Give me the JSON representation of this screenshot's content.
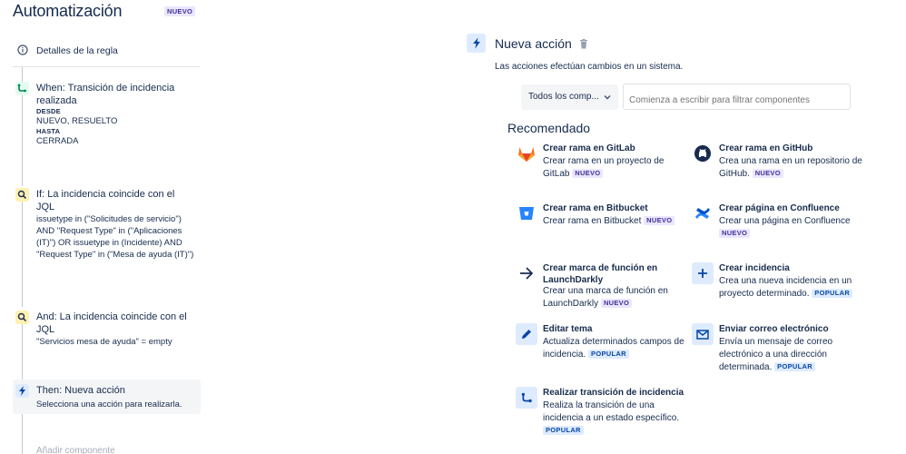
{
  "app": {
    "title": "Automatización",
    "badge": "NUEVO"
  },
  "rule_details": {
    "label": "Detalles de la regla"
  },
  "steps": [
    {
      "title": "When: Transición de incidencia realizada",
      "from_caption": "DESDE",
      "from_value": "NUEVO, RESUELTO",
      "to_caption": "HASTA",
      "to_value": "CERRADA"
    },
    {
      "title": "If: La incidencia coincide con el JQL",
      "body": "issuetype in (\"Solicitudes de servicio\") AND \"Request Type\" in (\"Aplicaciones (IT)\") OR issuetype in (Incidente) AND \"Request Type\" in (\"Mesa de ayuda (IT)\")"
    },
    {
      "title": "And: La incidencia coincide con el JQL",
      "body": "\"Servicios mesa de ayuda\" = empty"
    },
    {
      "title": "Then: Nueva acción",
      "body": "Selecciona una acción para realizarla."
    }
  ],
  "add_component": "Añadir componente",
  "panel": {
    "title": "Nueva acción",
    "description": "Las acciones efectúan cambios en un sistema.",
    "select_value": "Todos los comp...",
    "filter_placeholder": "Comienza a escribir para filtrar componentes",
    "section_title": "Recomendado"
  },
  "actions": [
    {
      "title": "Crear rama en GitLab",
      "desc": "Crear rama en un proyecto de GitLab",
      "pill": "NUEVO",
      "icon": "gitlab-icon"
    },
    {
      "title": "Crear rama en GitHub",
      "desc": "Crea una rama en un repositorio de GitHub.",
      "pill": "NUEVO",
      "icon": "github-icon"
    },
    {
      "title": "Crear rama en Bitbucket",
      "desc": "Crear rama en Bitbucket",
      "pill": "NUEVO",
      "icon": "bitbucket-icon"
    },
    {
      "title": "Crear página en Confluence",
      "desc": "Crear una página en Confluence",
      "pill": "NUEVO",
      "icon": "confluence-icon"
    },
    {
      "title": "Crear marca de función en LaunchDarkly",
      "desc": "Crear una marca de función en LaunchDarkly",
      "pill": "NUEVO",
      "icon": "launchdarkly-icon"
    },
    {
      "title": "Crear incidencia",
      "desc": "Crea una nueva incidencia en un proyecto determinado.",
      "pill": "POPULAR",
      "icon": "plus-icon"
    },
    {
      "title": "Editar tema",
      "desc": "Actualiza determinados campos de incidencia.",
      "pill": "POPULAR",
      "icon": "pencil-icon"
    },
    {
      "title": "Enviar correo electrónico",
      "desc": "Envía un mensaje de correo electrónico a una dirección determinada.",
      "pill": "POPULAR",
      "icon": "mail-icon"
    },
    {
      "title": "Realizar transición de incidencia",
      "desc": "Realiza la transición de una incidencia a un estado específico.",
      "pill": "POPULAR",
      "icon": "transition-icon"
    }
  ],
  "colors": {
    "accent": "#0052cc",
    "trigger": "#36b37e",
    "condition": "#ffc400",
    "action": "#deebff",
    "popular": "#0747a6",
    "new": "#403294"
  }
}
